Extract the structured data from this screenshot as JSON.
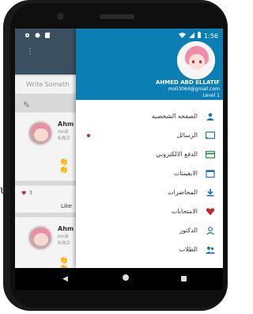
{
  "outside_text": "u",
  "status_bar": {
    "time": "1:56"
  },
  "app": {
    "compose_placeholder": "Write Someth",
    "post1": {
      "name": "Ahm",
      "sub": "mrdi",
      "date": "6/8/2"
    },
    "post2": {
      "name": "Ahm",
      "sub": "mrdi",
      "date": "6/8/2"
    },
    "likes_count": "3",
    "likes_label": "Like"
  },
  "drawer": {
    "user_name": "AHMED ABD ELLATIF",
    "email": "moli3064@gmail.com",
    "level": "Level 1",
    "items": [
      {
        "label": "الصفحه الشخصيه",
        "icon": "person-icon",
        "color": "#1a73b8"
      },
      {
        "label": "الرسائل",
        "icon": "message-icon",
        "color": "#1a73b8",
        "badge": true
      },
      {
        "label": "الدفع الالكتروني",
        "icon": "card-icon",
        "color": "#1b8a3b"
      },
      {
        "label": "الايفينتات",
        "icon": "calendar-icon",
        "color": "#1a73b8"
      },
      {
        "label": "المحاضرات",
        "icon": "download-icon",
        "color": "#1a73b8"
      },
      {
        "label": "الامتحانات",
        "icon": "heart-icon",
        "color": "#c0272d"
      },
      {
        "label": "الدكتور",
        "icon": "doctor-icon",
        "color": "#1a73b8"
      },
      {
        "label": "الطلاب",
        "icon": "group-icon",
        "color": "#1a73b8"
      }
    ]
  }
}
